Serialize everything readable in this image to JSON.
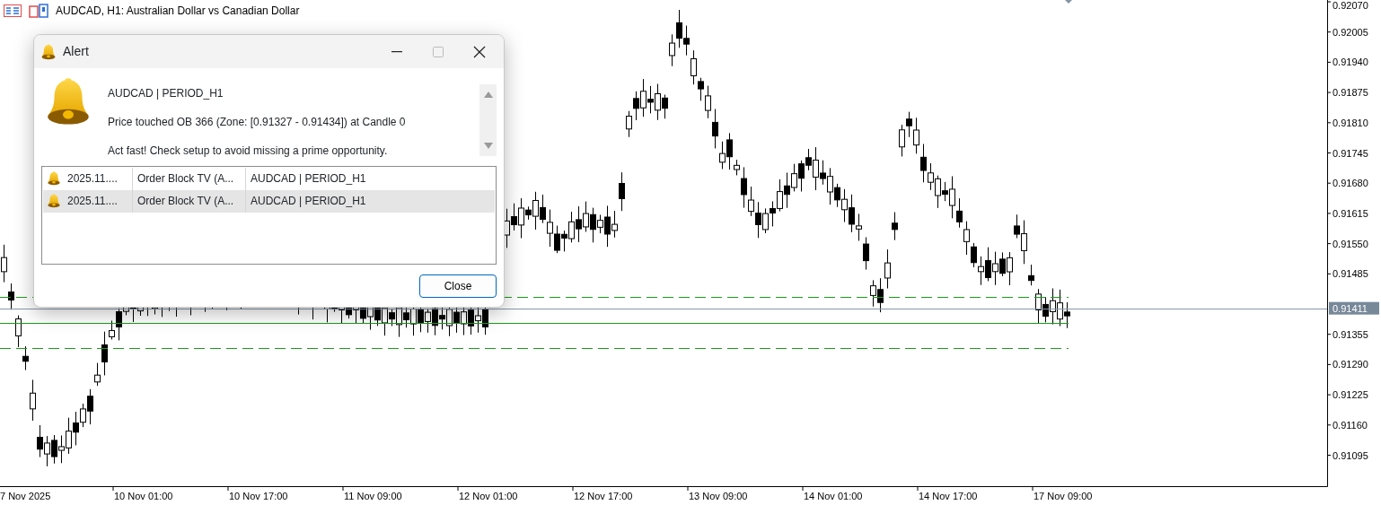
{
  "chart_header": {
    "title": "AUDCAD, H1:  Australian Dollar vs Canadian Dollar"
  },
  "price_axis": {
    "ticks": [
      "0.92070",
      "0.92005",
      "0.91940",
      "0.91875",
      "0.91810",
      "0.91745",
      "0.91680",
      "0.91615",
      "0.91550",
      "0.91485",
      "0.91355",
      "0.91290",
      "0.91225",
      "0.91160",
      "0.91095"
    ],
    "current_price": "0.91411"
  },
  "time_axis": {
    "ticks": [
      "7 Nov 2025",
      "10 Nov 01:00",
      "10 Nov 17:00",
      "11 Nov 09:00",
      "12 Nov 01:00",
      "12 Nov 17:00",
      "13 Nov 09:00",
      "14 Nov 01:00",
      "14 Nov 17:00",
      "17 Nov 09:00"
    ]
  },
  "alert_dialog": {
    "title": "Alert",
    "message_lines": [
      "AUDCAD | PERIOD_H1",
      "Price touched OB 366 (Zone: [0.91327 - 0.91434]) at Candle 0",
      "Act fast! Check setup to avoid missing a prime opportunity."
    ],
    "alerts": [
      {
        "time": "2025.11....",
        "source": "Order Block TV (A...",
        "message": "AUDCAD | PERIOD_H1",
        "selected": false
      },
      {
        "time": "2025.11....",
        "source": "Order Block TV (A...",
        "message": "AUDCAD | PERIOD_H1",
        "selected": true
      }
    ],
    "close_button": "Close"
  }
}
